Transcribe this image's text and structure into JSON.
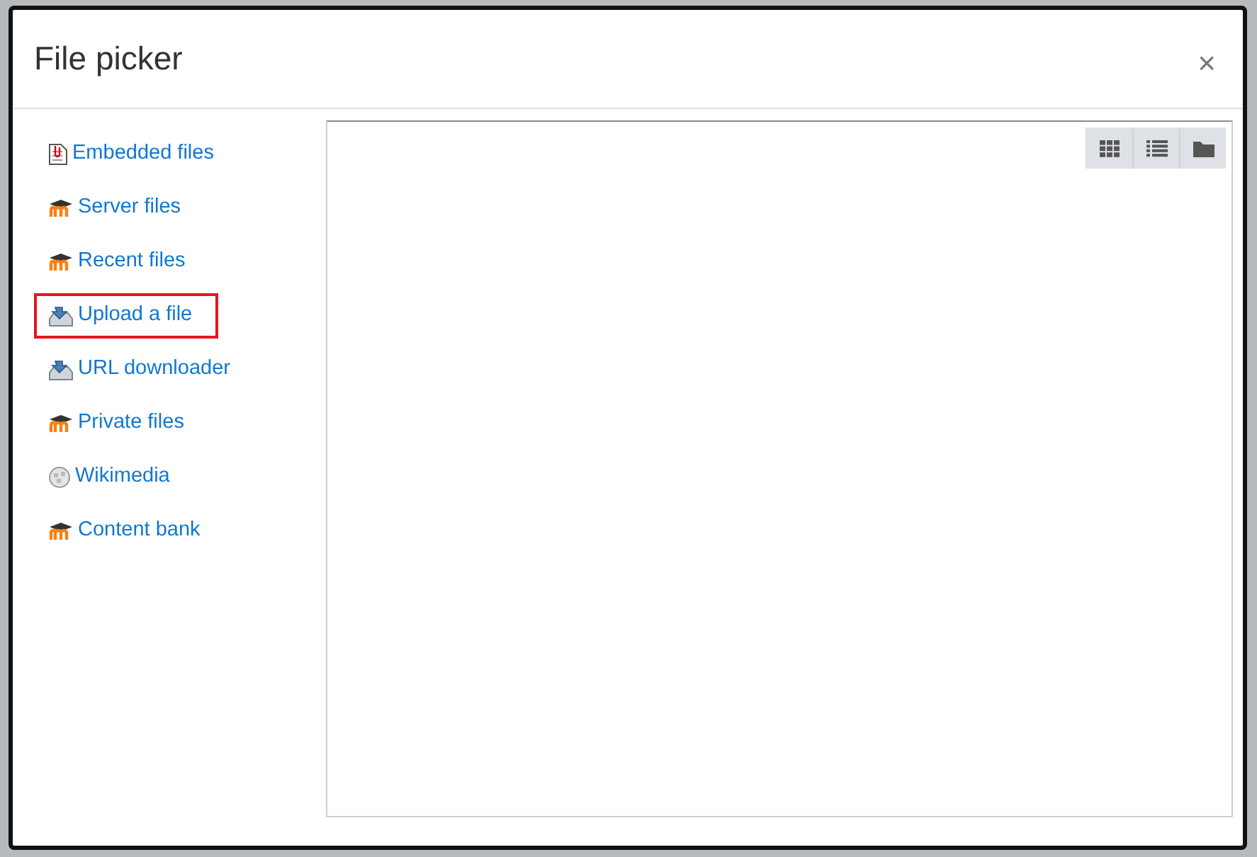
{
  "dialog": {
    "title": "File picker",
    "close": "×"
  },
  "repositories": [
    {
      "label": "Embedded files",
      "kind": "document",
      "highlighted": false
    },
    {
      "label": "Server files",
      "kind": "moodle",
      "highlighted": false
    },
    {
      "label": "Recent files",
      "kind": "moodle",
      "highlighted": false
    },
    {
      "label": "Upload a file",
      "kind": "upload",
      "highlighted": true
    },
    {
      "label": "URL downloader",
      "kind": "upload",
      "highlighted": false
    },
    {
      "label": "Private files",
      "kind": "moodle",
      "highlighted": false
    },
    {
      "label": "Wikimedia",
      "kind": "wikimedia",
      "highlighted": false
    },
    {
      "label": "Content bank",
      "kind": "moodle",
      "highlighted": false
    }
  ],
  "view_buttons": [
    {
      "kind": "icons"
    },
    {
      "kind": "list"
    },
    {
      "kind": "folder"
    }
  ]
}
